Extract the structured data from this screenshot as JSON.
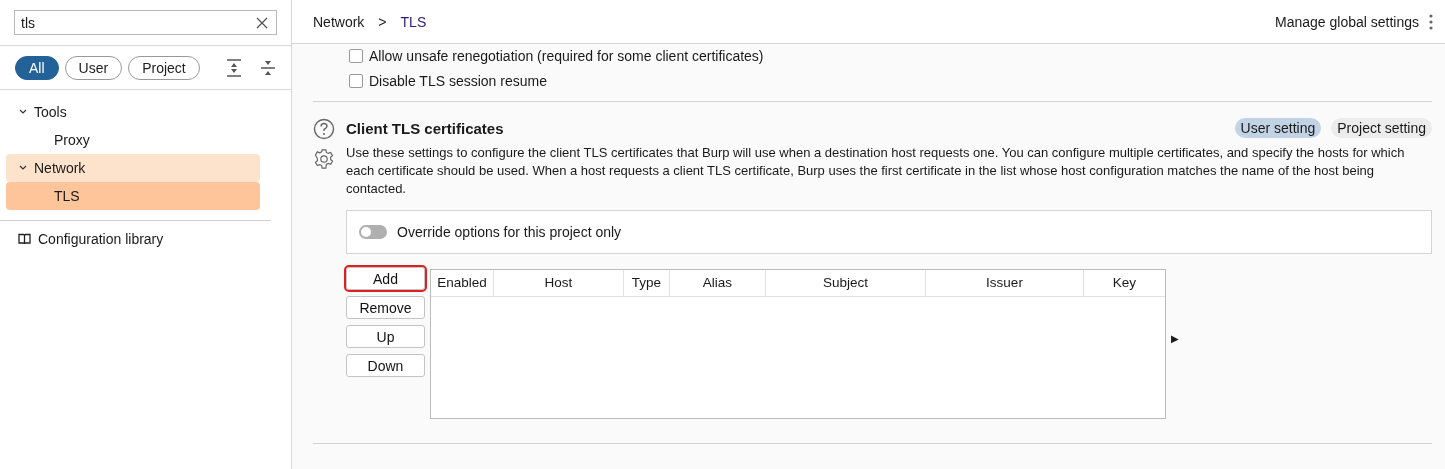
{
  "sidebar": {
    "search": {
      "value": "tls"
    },
    "filters": [
      {
        "label": "All",
        "selected": true
      },
      {
        "label": "User",
        "selected": false
      },
      {
        "label": "Project",
        "selected": false
      }
    ],
    "tree": [
      {
        "label": "Tools",
        "expanded": true,
        "selected": false,
        "children": [
          {
            "label": "Proxy",
            "selected": false
          }
        ]
      },
      {
        "label": "Network",
        "expanded": true,
        "selected": false,
        "children": [
          {
            "label": "TLS",
            "selected": true
          }
        ]
      }
    ],
    "library": "Configuration library"
  },
  "header": {
    "breadcrumb": [
      "Network",
      "TLS"
    ],
    "separator": ">",
    "manage": "Manage global settings"
  },
  "options": [
    {
      "label": "Allow unsafe renegotiation (required for some client certificates)",
      "checked": false
    },
    {
      "label": "Disable TLS session resume",
      "checked": false
    }
  ],
  "section": {
    "title": "Client TLS certificates",
    "scopes": [
      {
        "label": "User setting",
        "selected": true
      },
      {
        "label": "Project setting",
        "selected": false
      }
    ],
    "description": "Use these settings to configure the client TLS certificates that Burp will use when a destination host requests one. You can configure multiple certificates, and specify the hosts for which each certificate should be used. When a host requests a client TLS certificate, Burp uses the first certificate in the list whose host configuration matches the name of the host being contacted.",
    "override": {
      "label": "Override options for this project only",
      "on": false
    },
    "buttons": [
      {
        "label": "Add",
        "highlighted": true
      },
      {
        "label": "Remove",
        "highlighted": false
      },
      {
        "label": "Up",
        "highlighted": false
      },
      {
        "label": "Down",
        "highlighted": false
      }
    ],
    "table": {
      "columns": [
        "Enabled",
        "Host",
        "Type",
        "Alias",
        "Subject",
        "Issuer",
        "Key"
      ]
    },
    "arrow": "▶"
  }
}
